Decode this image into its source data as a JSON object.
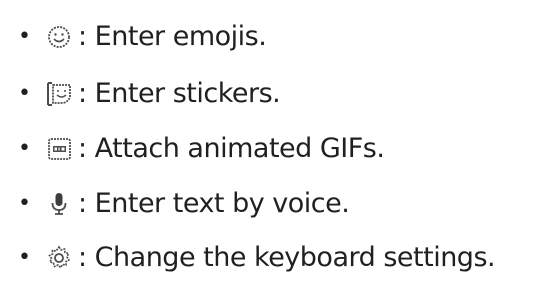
{
  "items": [
    {
      "bullet": "•",
      "icon": "emoji-icon",
      "text": ": Enter emojis."
    },
    {
      "bullet": "•",
      "icon": "sticker-icon",
      "text": ": Enter stickers."
    },
    {
      "bullet": "•",
      "icon": "gif-icon",
      "text": ": Attach animated GIFs."
    },
    {
      "bullet": "•",
      "icon": "microphone-icon",
      "text": ": Enter text by voice."
    },
    {
      "bullet": "•",
      "icon": "settings-gear-icon",
      "text": ": Change the keyboard settings."
    }
  ],
  "colors": {
    "text": "#231f20",
    "icon_stroke": "#4d4d4d"
  }
}
